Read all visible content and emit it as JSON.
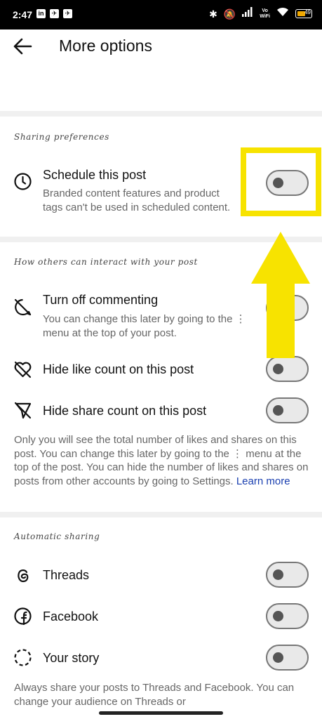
{
  "status_bar": {
    "time": "2:47",
    "app_icons": [
      "linkedin-icon",
      "telegram-icon",
      "telegram-icon"
    ],
    "vo_label": "Vo",
    "wifi_label": "WiFi",
    "battery_level": "49"
  },
  "header": {
    "title": "More options"
  },
  "sections": {
    "sharing_label": "Sharing preferences",
    "interact_label": "How others can interact with your post",
    "auto_label": "Automatic sharing"
  },
  "schedule": {
    "title": "Schedule this post",
    "subtitle": "Branded content features and product tags can't be used in scheduled content.",
    "enabled": false
  },
  "commenting": {
    "title": "Turn off commenting",
    "subtitle": "You can change this later by going to the ⋮ menu at the top of your post.",
    "enabled": false
  },
  "like_count": {
    "title": "Hide like count on this post",
    "enabled": false
  },
  "share_count": {
    "title": "Hide share count on this post",
    "enabled": false
  },
  "counts_note": {
    "text": "Only you will see the total number of likes and shares on this post. You can change this later by going to the ⋮ menu at the top of the post. You can hide the number of likes and shares on posts from other accounts by going to Settings.",
    "link": "Learn more"
  },
  "threads": {
    "title": "Threads",
    "enabled": false
  },
  "facebook": {
    "title": "Facebook",
    "enabled": false
  },
  "story": {
    "title": "Your story",
    "enabled": false
  },
  "auto_note": {
    "text": "Always share your posts to Threads and Facebook. You can change your audience on Threads or"
  },
  "colors": {
    "highlight": "#f7e300",
    "link": "#1a3fb0"
  }
}
